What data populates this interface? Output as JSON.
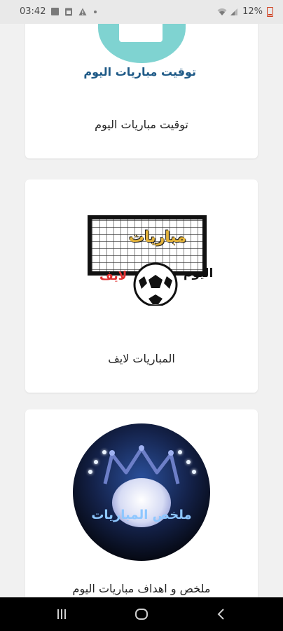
{
  "status_bar": {
    "time": "03:42",
    "battery": "12%"
  },
  "cards": [
    {
      "title": "توقيت مباريات اليوم",
      "logo_text": "توقيت مباريات اليوم"
    },
    {
      "title": "المباريات لايف",
      "logo_text_main": "مباريات",
      "logo_text_black": "اليوم",
      "logo_text_red": "لايف"
    },
    {
      "title": "ملخص و اهداف مباريات اليوم",
      "logo_text": "ملخص المباريات"
    }
  ],
  "colors": {
    "background": "#f1f1f1",
    "card": "#ffffff",
    "accent_teal": "#7fd3d1",
    "logo_red": "#e03030",
    "logo_gold": "#e2b23a"
  }
}
